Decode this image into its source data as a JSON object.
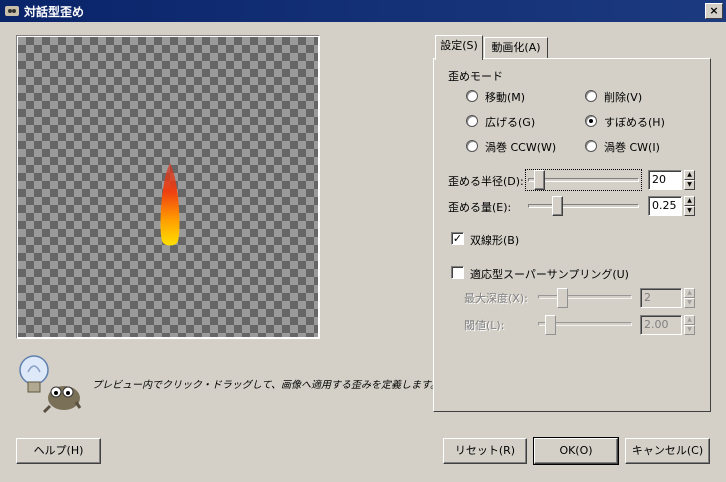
{
  "window": {
    "title": "対話型歪め",
    "close_label": "×"
  },
  "preview": {
    "hint": "プレビュー内でクリック・ドラッグして、画像へ適用する歪みを定義します。"
  },
  "tabs": [
    {
      "label": "設定(S)",
      "active": true
    },
    {
      "label": "動画化(A)",
      "active": false
    }
  ],
  "settings": {
    "mode_group_label": "歪めモード",
    "modes": [
      {
        "label": "移動(M)",
        "selected": false
      },
      {
        "label": "削除(V)",
        "selected": false
      },
      {
        "label": "広げる(G)",
        "selected": false
      },
      {
        "label": "すぼめる(H)",
        "selected": true
      },
      {
        "label": "渦巻 CCW(W)",
        "selected": false
      },
      {
        "label": "渦巻 CW(I)",
        "selected": false
      }
    ],
    "radius": {
      "label": "歪める半径(D):",
      "value": "20"
    },
    "amount": {
      "label": "歪める量(E):",
      "value": "0.25"
    },
    "bilinear": {
      "label": "双線形(B)",
      "checked": true
    },
    "supersampling": {
      "label": "適応型スーパーサンプリング(U)",
      "checked": false
    },
    "max_depth": {
      "label": "最大深度(X):",
      "value": "2"
    },
    "threshold": {
      "label": "閾値(L):",
      "value": "2.00"
    }
  },
  "buttons": {
    "help": "ヘルプ(H)",
    "reset": "リセット(R)",
    "ok": "OK(O)",
    "cancel": "キャンセル(C)"
  },
  "icons": {
    "app": "gimp-icon",
    "close": "close-icon",
    "hint": "lightbulb-wilber-icon",
    "spin_up": "up-arrow-icon",
    "spin_down": "down-arrow-icon"
  }
}
